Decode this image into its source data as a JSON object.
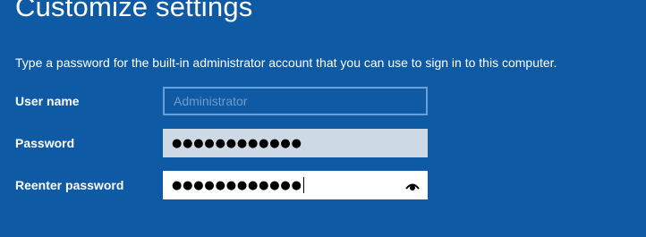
{
  "page": {
    "title": "Customize settings",
    "instructions": "Type a password for the built-in administrator account that you can use to sign in to this computer."
  },
  "fields": {
    "username": {
      "label": "User name",
      "value": "Administrator"
    },
    "password": {
      "label": "Password",
      "masked_value": "●●●●●●●●●●●●"
    },
    "reenter": {
      "label": "Reenter password",
      "masked_value": "●●●●●●●●●●●●",
      "reveal_icon": "eye-icon"
    }
  },
  "colors": {
    "background": "#0f5aa4",
    "text": "#ffffff",
    "disabled_text": "#6f9ccb",
    "input_border": "#6aa0d6",
    "password_fill": "#cdd9e4",
    "active_fill": "#ffffff"
  }
}
